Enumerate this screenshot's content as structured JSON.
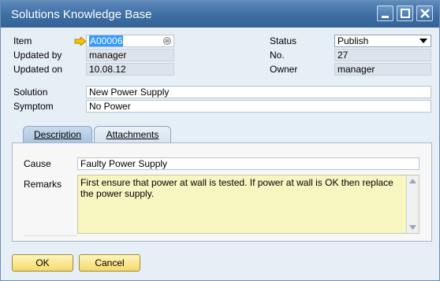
{
  "window": {
    "title": "Solutions Knowledge Base"
  },
  "header": {
    "item_label": "Item",
    "item_value": "A00006",
    "updated_by_label": "Updated by",
    "updated_by_value": "manager",
    "updated_on_label": "Updated on",
    "updated_on_value": "10.08.12",
    "status_label": "Status",
    "status_value": "Publish",
    "no_label": "No.",
    "no_value": "27",
    "owner_label": "Owner",
    "owner_value": "manager"
  },
  "solution": {
    "label": "Solution",
    "value": "New Power Supply"
  },
  "symptom": {
    "label": "Symptom",
    "value": "No Power"
  },
  "tabs": [
    {
      "label": "Description",
      "active": true
    },
    {
      "label": "Attachments",
      "active": false
    }
  ],
  "description": {
    "cause_label": "Cause",
    "cause_value": "Faulty Power Supply",
    "remarks_label": "Remarks",
    "remarks_value": "First ensure that power at wall is tested. If power at wall is OK then replace the power supply."
  },
  "buttons": {
    "ok": "OK",
    "cancel": "Cancel"
  },
  "colors": {
    "titlebar": "#3f6fa5",
    "highlight": "#f7f5c0",
    "selected": "#3399ff",
    "button": "#f6d96a"
  }
}
